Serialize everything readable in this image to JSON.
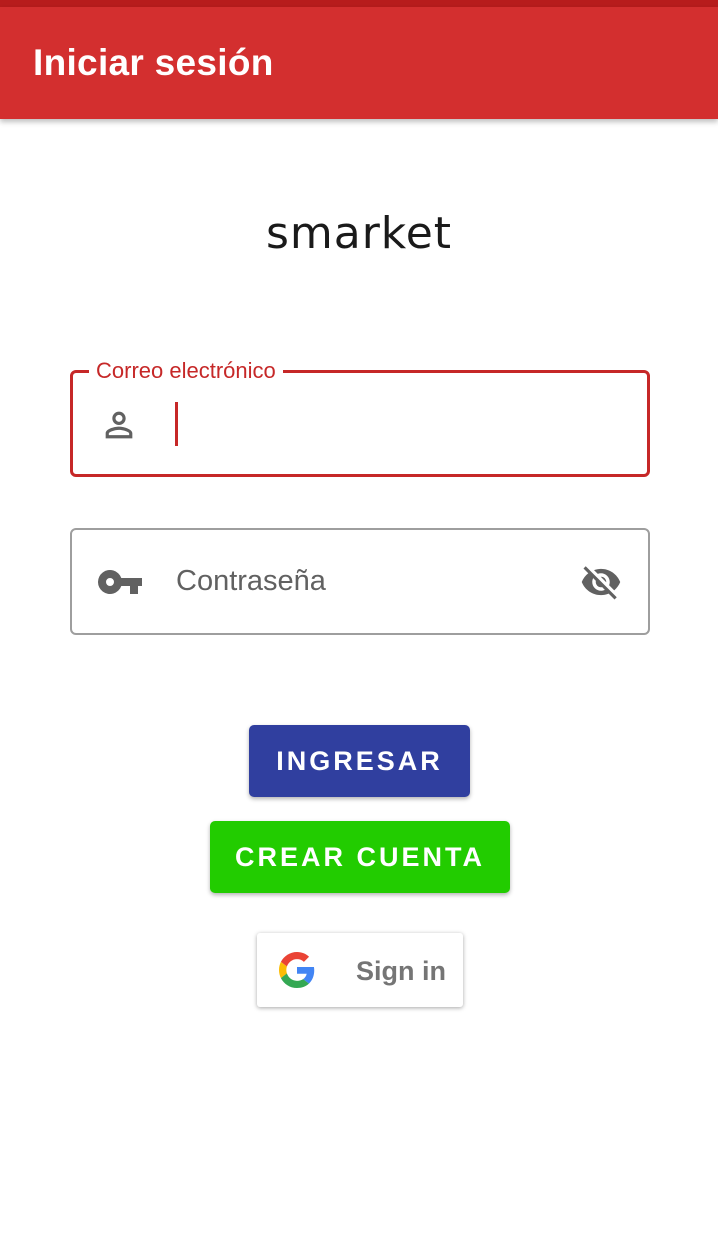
{
  "app_bar": {
    "title": "Iniciar sesión"
  },
  "logo": {
    "text": "smarket"
  },
  "email_field": {
    "label": "Correo electrónico",
    "value": "",
    "icon": "person-icon"
  },
  "password_field": {
    "placeholder": "Contraseña",
    "value": "",
    "icon": "key-icon",
    "toggle_icon": "eye-off-icon"
  },
  "buttons": {
    "login_label": "INGRESAR",
    "create_account_label": "CREAR CUENTA",
    "google_label": "Sign in"
  },
  "colors": {
    "app_bar": "#d32f2f",
    "error": "#c62828",
    "login_button": "#303f9f",
    "create_button": "#22cc00"
  }
}
